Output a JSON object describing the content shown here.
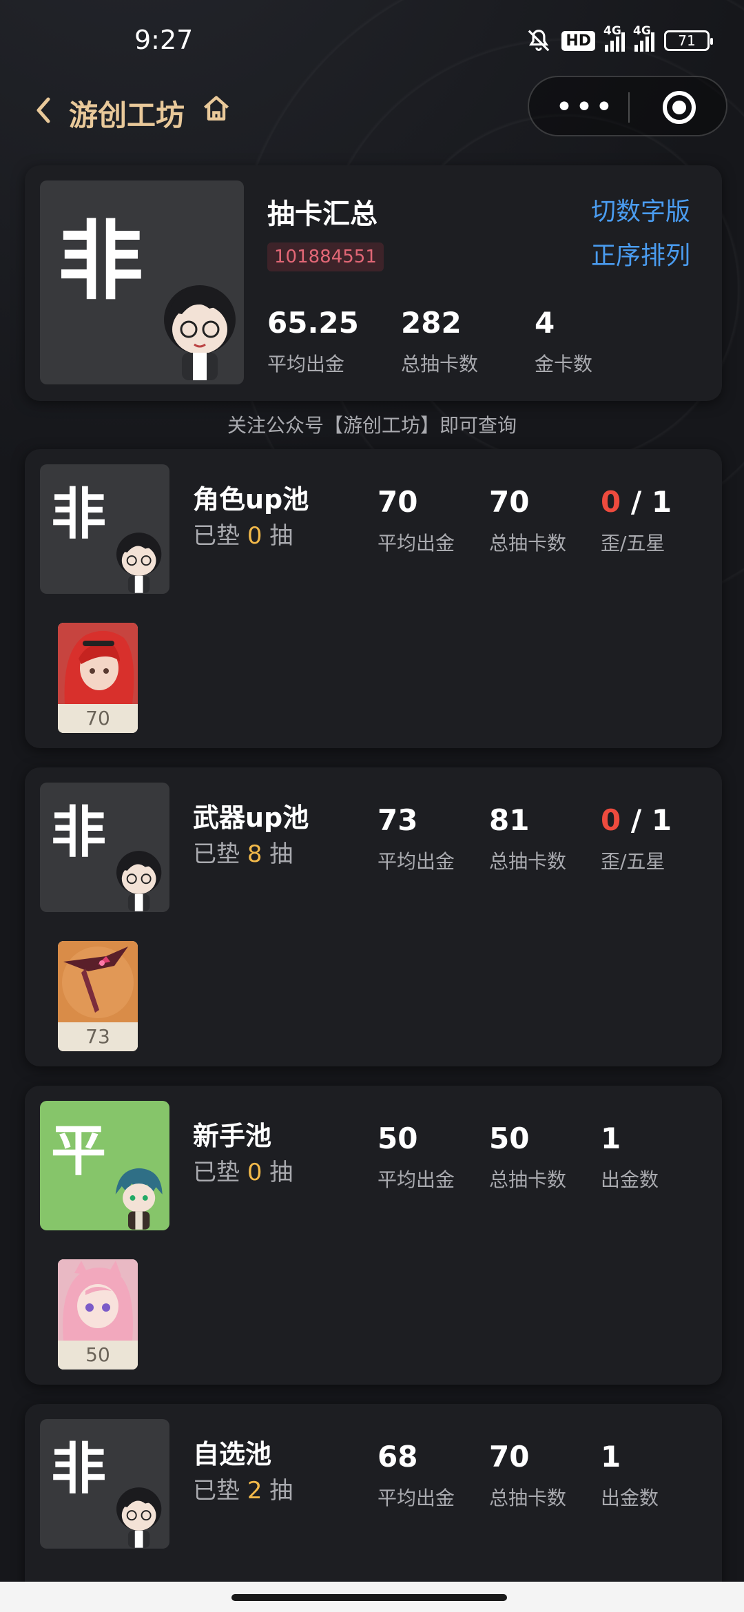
{
  "status": {
    "time": "9:27",
    "hd": "HD",
    "net1": "4G",
    "net2": "4G",
    "battery": "71"
  },
  "nav": {
    "back_icon": "chevron-left-icon",
    "title": "游创工坊",
    "home_icon": "home-icon",
    "more_icon": "more-dots-icon",
    "close_icon": "target-icon"
  },
  "summary": {
    "badge_char": "非",
    "title": "抽卡汇总",
    "uid": "101884551",
    "switch_label": "切数字版",
    "order_label": "正序排列",
    "stats": [
      {
        "value": "65.25",
        "label": "平均出金"
      },
      {
        "value": "282",
        "label": "总抽卡数"
      },
      {
        "value": "4",
        "label": "金卡数"
      }
    ]
  },
  "notice": "关注公众号【游创工坊】即可查询",
  "pools": [
    {
      "badge_char": "非",
      "badge_color": "#38393c",
      "name": "角色up池",
      "pity_prefix": "已垫",
      "pity": "0",
      "pity_suffix": "抽",
      "avg": "70",
      "avg_label": "平均出金",
      "total": "70",
      "total_label": "总抽卡数",
      "third_red": "0",
      "third_rest": " / 1",
      "third_label": "歪/五星",
      "items": [
        {
          "count": "70",
          "art": "red-hair-character"
        }
      ]
    },
    {
      "badge_char": "非",
      "badge_color": "#38393c",
      "name": "武器up池",
      "pity_prefix": "已垫",
      "pity": "8",
      "pity_suffix": "抽",
      "avg": "73",
      "avg_label": "平均出金",
      "total": "81",
      "total_label": "总抽卡数",
      "third_red": "0",
      "third_rest": " / 1",
      "third_label": "歪/五星",
      "items": [
        {
          "count": "73",
          "art": "weapon"
        }
      ]
    },
    {
      "badge_char": "平",
      "badge_color": "#86c56a",
      "name": "新手池",
      "pity_prefix": "已垫",
      "pity": "0",
      "pity_suffix": "抽",
      "avg": "50",
      "avg_label": "平均出金",
      "total": "50",
      "total_label": "总抽卡数",
      "third_red": "",
      "third_rest": "1",
      "third_label": "出金数",
      "items": [
        {
          "count": "50",
          "art": "pink-hair-character"
        }
      ]
    },
    {
      "badge_char": "非",
      "badge_color": "#38393c",
      "name": "自选池",
      "pity_prefix": "已垫",
      "pity": "2",
      "pity_suffix": "抽",
      "avg": "68",
      "avg_label": "平均出金",
      "total": "70",
      "total_label": "总抽卡数",
      "third_red": "",
      "third_rest": "1",
      "third_label": "出金数",
      "items": []
    }
  ]
}
